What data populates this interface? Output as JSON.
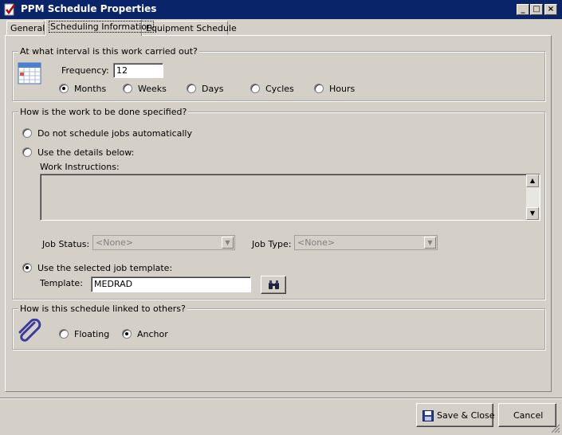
{
  "window": {
    "title": "PPM Schedule Properties",
    "minimize": "_",
    "maximize": "□",
    "close": "×"
  },
  "tabs": [
    {
      "label": "General"
    },
    {
      "label": "Scheduling Information"
    },
    {
      "label": "Equipment Schedule"
    }
  ],
  "interval": {
    "legend": "At what interval is this work carried out?",
    "frequency_label": "Frequency:",
    "frequency_value": "12",
    "units": [
      {
        "label": "Months",
        "selected": true
      },
      {
        "label": "Weeks",
        "selected": false
      },
      {
        "label": "Days",
        "selected": false
      },
      {
        "label": "Cycles",
        "selected": false
      },
      {
        "label": "Hours",
        "selected": false
      }
    ]
  },
  "work": {
    "legend": "How is the work to be done specified?",
    "opt_none": "Do not schedule jobs automatically",
    "opt_details": "Use the details below:",
    "instructions_label": "Work Instructions:",
    "instructions_value": "",
    "job_status_label": "Job Status:",
    "job_status_value": "<None>",
    "job_type_label": "Job Type:",
    "job_type_value": "<None>",
    "opt_template": "Use the selected job template:",
    "template_label": "Template:",
    "template_value": "MEDRAD"
  },
  "link": {
    "legend": "How is this schedule linked to others?",
    "floating": "Floating",
    "anchor": "Anchor"
  },
  "buttons": {
    "save_close": "Save & Close",
    "cancel": "Cancel"
  }
}
